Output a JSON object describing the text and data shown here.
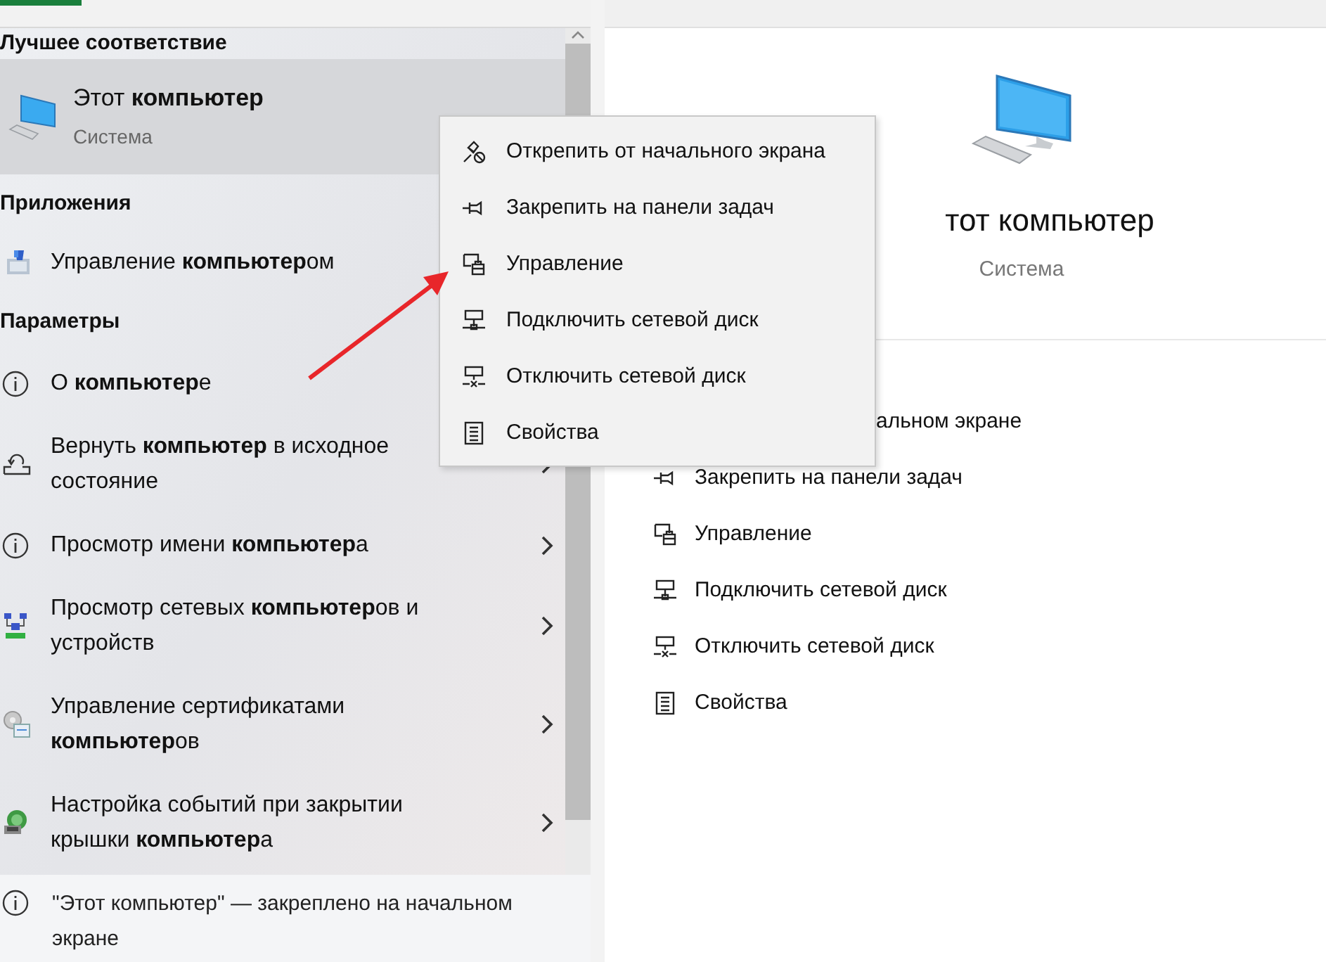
{
  "sections": [
    {
      "heading": "Лучшее соответствие",
      "items": [
        {
          "kind": "best",
          "title": "Этот **компьютер**",
          "subtitle": "Система",
          "selected": true
        }
      ]
    },
    {
      "heading": "Приложения",
      "items": [
        {
          "kind": "app",
          "title": "Управление **компьютер**ом"
        }
      ]
    },
    {
      "heading": "Параметры",
      "items": [
        {
          "kind": "setting",
          "title": "О **компьютер**е",
          "chevron": false
        },
        {
          "kind": "setting",
          "title": "Вернуть **компьютер** в исходное состояние",
          "chevron": true
        },
        {
          "kind": "setting",
          "title": "Просмотр имени **компьютер**а",
          "chevron": true
        },
        {
          "kind": "setting",
          "title": "Просмотр сетевых **компьютер**ов и устройств",
          "chevron": true
        },
        {
          "kind": "setting",
          "title": "Управление сертификатами **компьютер**ов",
          "chevron": true
        },
        {
          "kind": "setting",
          "title": "Настройка событий при закрытии крышки **компьютер**а",
          "chevron": true
        }
      ]
    }
  ],
  "footer": {
    "text": "\"Этот компьютер\" — закреплено на начальном экране"
  },
  "details": {
    "title": "тот компьютер",
    "subtitle": "Система",
    "actions": [
      {
        "label": "альном экране"
      },
      {
        "label": "Закрепить на панели задач"
      },
      {
        "label": "Управление"
      },
      {
        "label": "Подключить сетевой диск"
      },
      {
        "label": "Отключить сетевой диск"
      },
      {
        "label": "Свойства"
      }
    ]
  },
  "context_menu": {
    "items": [
      {
        "label": "Открепить от начального экрана"
      },
      {
        "label": "Закрепить на панели задач"
      },
      {
        "label": "Управление"
      },
      {
        "label": "Подключить сетевой диск"
      },
      {
        "label": "Отключить сетевой диск"
      },
      {
        "label": "Свойства"
      }
    ]
  }
}
